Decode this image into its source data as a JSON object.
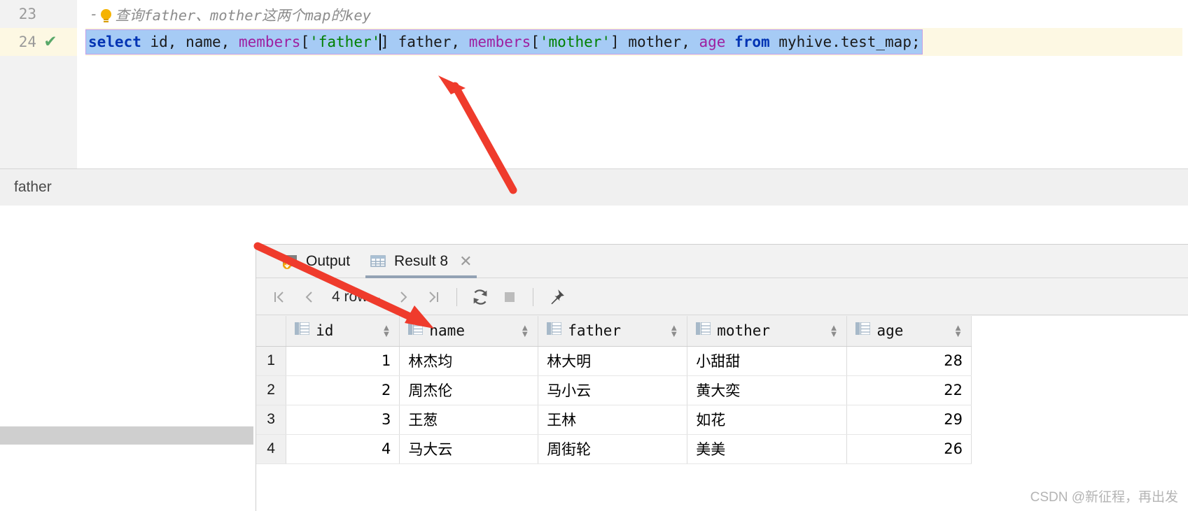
{
  "editor": {
    "lines": [
      {
        "number": "23",
        "marker": "",
        "kind": "comment"
      },
      {
        "number": "24",
        "marker": "check",
        "kind": "sql"
      }
    ],
    "comment_text": "查询father、mother这两个map的key",
    "comment_dash": "-",
    "sql": {
      "t1": "select",
      "t2": " id, name, ",
      "t3": "members",
      "t4": "[",
      "t5": "'father'",
      "t6": "]",
      "t7": " father, ",
      "t8": "members",
      "t9": "[",
      "t10": "'mother'",
      "t11": "]",
      "t12": " mother, ",
      "t13": "age",
      "t14": " ",
      "t15": "from",
      "t16": " myhive.test_map;"
    }
  },
  "strip": {
    "label": "father"
  },
  "results": {
    "tabs": [
      {
        "label": "Output",
        "icon": "console-icon",
        "active": false,
        "closable": false
      },
      {
        "label": "Result 8",
        "icon": "grid-icon",
        "active": true,
        "closable": true,
        "close_glyph": "✕"
      }
    ],
    "toolbar": {
      "first_label": "|<",
      "prev_label": "‹",
      "row_count": "4 row",
      "dropdown_glyph": "⌄",
      "next_label": "›",
      "last_label": ">|",
      "refresh_name": "refresh-icon",
      "stop_name": "stop-icon",
      "pin_name": "pin-icon"
    },
    "grid": {
      "columns": [
        {
          "key": "id",
          "label": "id",
          "align": "right"
        },
        {
          "key": "name",
          "label": "name",
          "align": "left"
        },
        {
          "key": "father",
          "label": "father",
          "align": "left"
        },
        {
          "key": "mother",
          "label": "mother",
          "align": "left"
        },
        {
          "key": "age",
          "label": "age",
          "align": "right"
        }
      ],
      "rows": [
        {
          "n": "1",
          "id": "1",
          "name": "林杰均",
          "father": "林大明",
          "mother": "小甜甜",
          "age": "28"
        },
        {
          "n": "2",
          "id": "2",
          "name": "周杰伦",
          "father": "马小云",
          "mother": "黄大奕",
          "age": "22"
        },
        {
          "n": "3",
          "id": "3",
          "name": "王葱",
          "father": "王林",
          "mother": "如花",
          "age": "29"
        },
        {
          "n": "4",
          "id": "4",
          "name": "马大云",
          "father": "周街轮",
          "mother": "美美",
          "age": "26"
        }
      ]
    }
  },
  "watermark": "CSDN @新征程，再出发",
  "colors": {
    "keyword": "#0033b3",
    "function": "#9e1fa0",
    "string": "#008000",
    "selection": "#a6cbf5",
    "arrow": "#ef3b2c",
    "check": "#59a869",
    "tab_underline": "#93a2b4"
  }
}
